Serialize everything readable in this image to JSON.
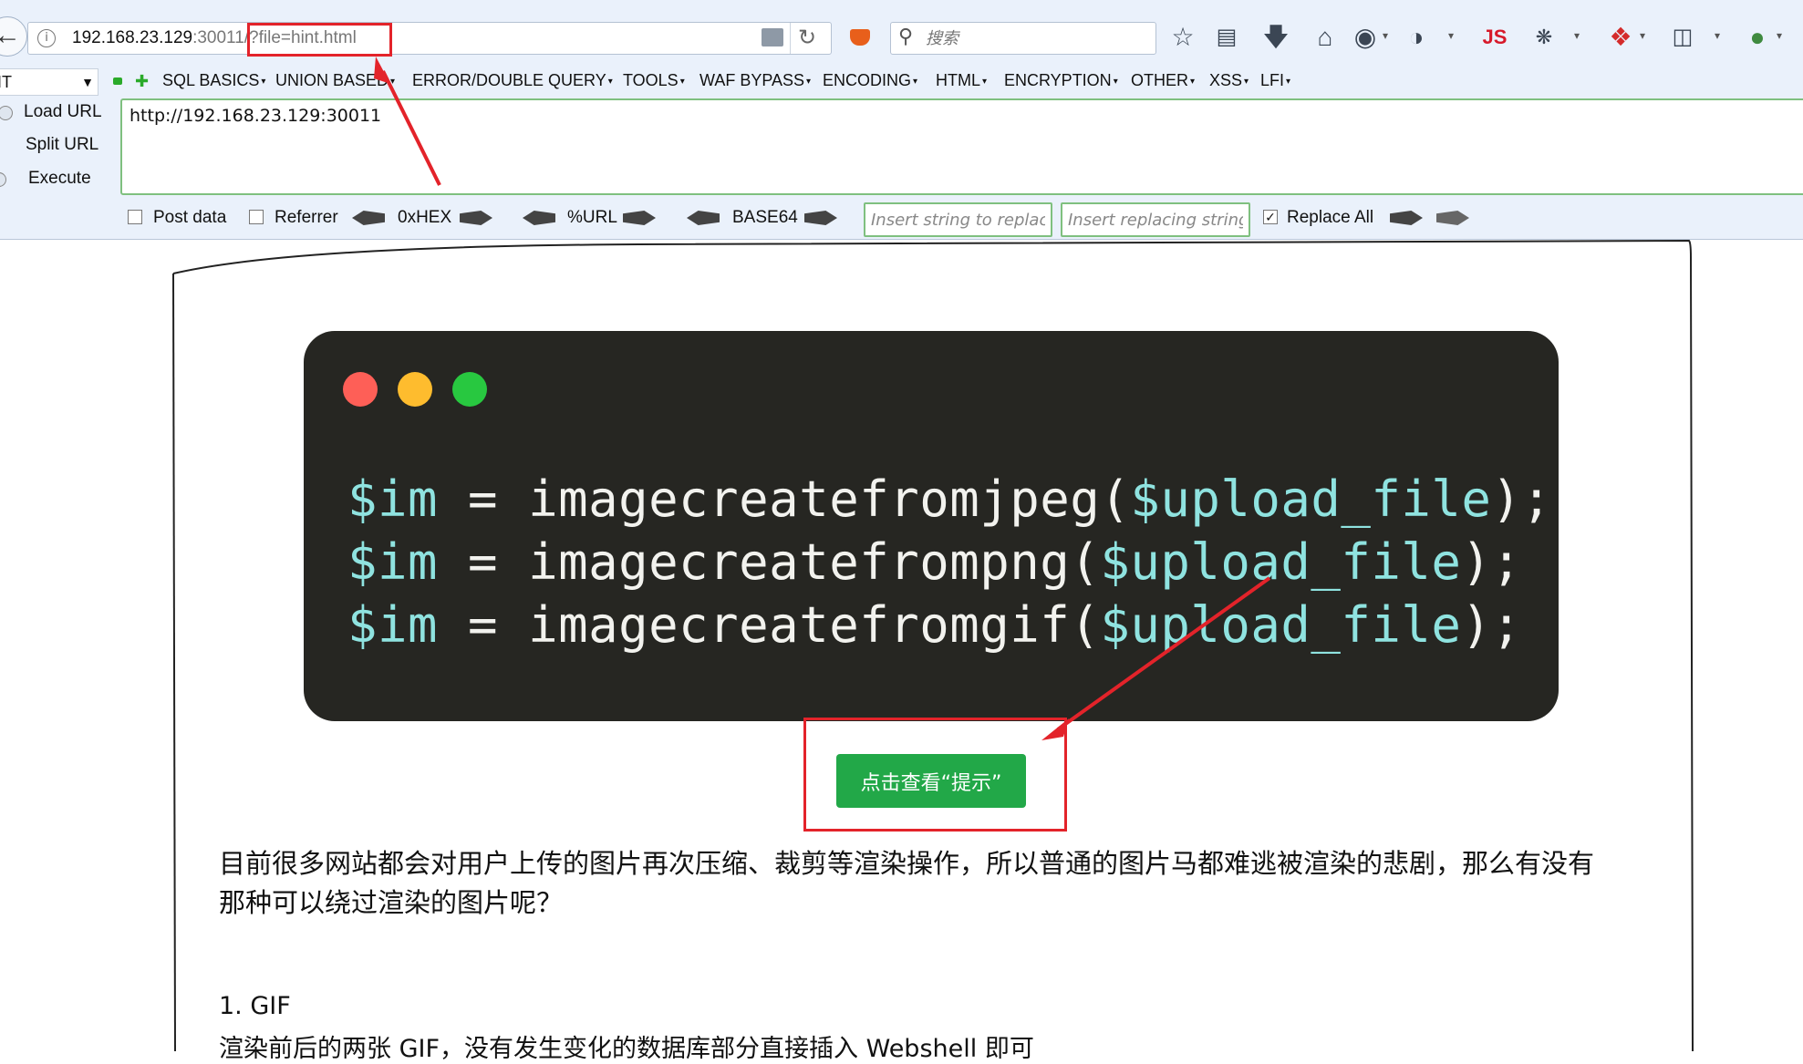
{
  "browser": {
    "url_host": "192.168.23.129",
    "url_port": ":30011",
    "url_query": "/?file=hint.html",
    "search_placeholder": "搜索",
    "js_label": "JS"
  },
  "hackbar": {
    "method": "IT",
    "menu": [
      "SQL BASICS",
      "UNION BASED",
      "ERROR/DOUBLE QUERY",
      "TOOLS",
      "WAF BYPASS",
      "ENCODING",
      "HTML",
      "ENCRYPTION",
      "OTHER",
      "XSS",
      "LFI"
    ],
    "load_url": "Load URL",
    "split_url": "Split URL",
    "execute": "Execute",
    "url_value": "http://192.168.23.129:30011",
    "post_data": "Post data",
    "referrer": "Referrer",
    "hex": "0xHEX",
    "urlenc": "%URL",
    "base64": "BASE64",
    "replace_placeholder": "Insert string to replace",
    "replacing_placeholder": "Insert replacing string",
    "replace_all": "Replace All",
    "replace_all_checked": true
  },
  "page": {
    "code": [
      {
        "var": "$im",
        "op": " = ",
        "fn": "imagecreatefromjpeg(",
        "arg": "$upload_file",
        "end": ");"
      },
      {
        "var": "$im",
        "op": " = ",
        "fn": "imagecreatefrompng(",
        "arg": "$upload_file",
        "end": ");"
      },
      {
        "var": "$im",
        "op": " = ",
        "fn": "imagecreatefromgif(",
        "arg": "$upload_file",
        "end": ");"
      }
    ],
    "hint_button": "点击查看“提示”",
    "para_line1": "目前很多网站都会对用户上传的图片再次压缩、裁剪等渲染操作，所以普通的图片马都难逃被渲染的悲剧，那么有没有",
    "para_line2": "那种可以绕过渲染的图片呢？",
    "section_title": "1. GIF",
    "section_text": "渲染前后的两张 GIF，没有发生变化的数据库部分直接插入 Webshell 即可"
  },
  "colors": {
    "annotation_red": "#e3232a",
    "button_green": "#22a848",
    "code_bg": "#262622",
    "code_var": "#8fe3e0",
    "traffic_red": "#fe5f57",
    "traffic_yellow": "#febc2e",
    "traffic_green": "#28c840"
  }
}
